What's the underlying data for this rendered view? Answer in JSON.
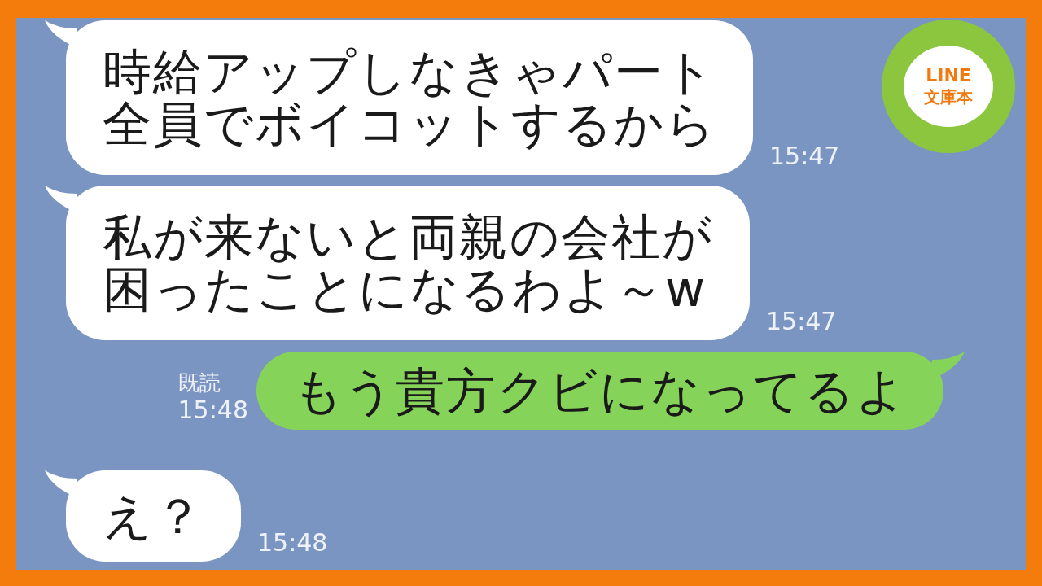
{
  "messages": [
    {
      "kind": "received",
      "lines": [
        "時給アップしなきゃパート",
        "全員でボイコットするから"
      ],
      "time": "15:47"
    },
    {
      "kind": "received",
      "lines": [
        "私が来ないと両親の会社が",
        "困ったことになるわよ～w"
      ],
      "time": "15:47"
    },
    {
      "kind": "sent",
      "lines": [
        "もう貴方クビになってるよ"
      ],
      "read": "既読",
      "time": "15:48"
    },
    {
      "kind": "received",
      "lines": [
        "え？"
      ],
      "time": "15:48"
    }
  ],
  "badge": {
    "top": "LINE",
    "bottom": "文庫本"
  }
}
